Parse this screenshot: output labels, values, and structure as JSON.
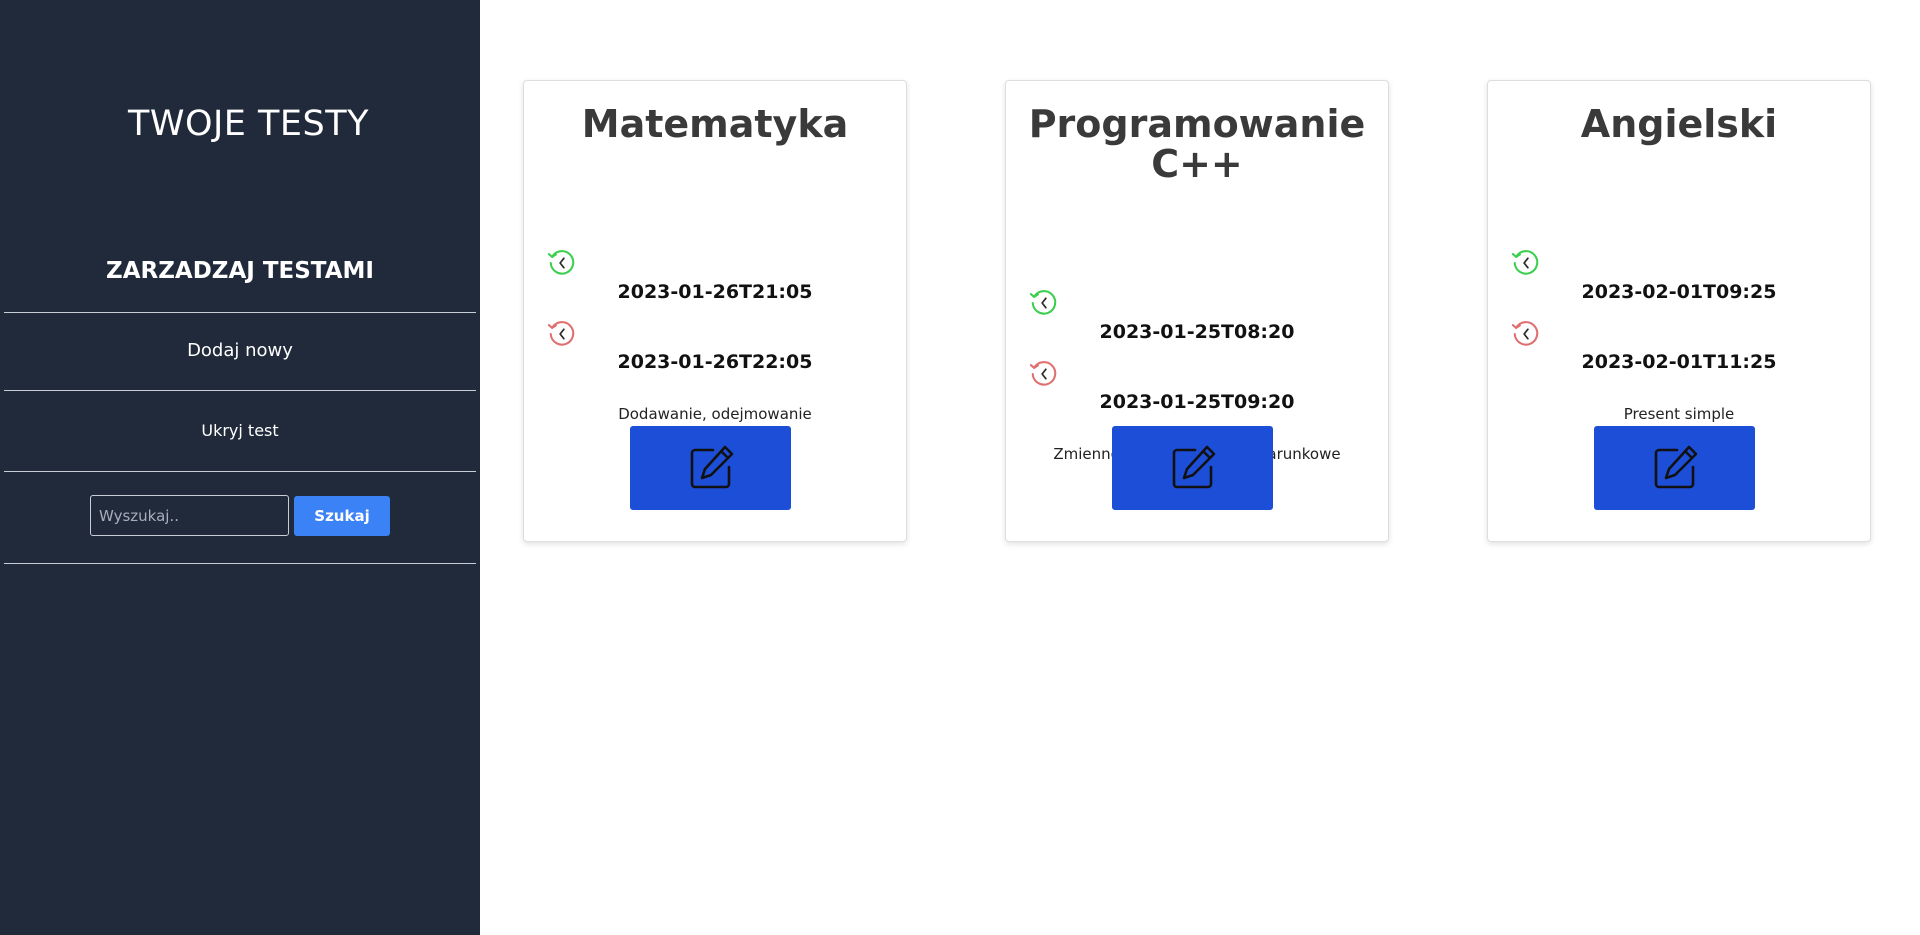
{
  "sidebar": {
    "title": "TWOJE TESTY",
    "manage_heading": "ZARZADZAJ TESTAMI",
    "add_new": "Dodaj nowy",
    "hide_test": "Ukryj test",
    "search_placeholder": "Wyszukaj..",
    "search_button": "Szukaj"
  },
  "colors": {
    "sidebar_bg": "#212a3a",
    "search_button": "#3b82f6",
    "edit_button": "#1d4ed8",
    "start_icon": "#3ccf4e",
    "end_icon": "#e07070"
  },
  "icons": {
    "start": "clock-history-start-icon",
    "end": "clock-history-end-icon",
    "edit": "edit-pencil-square-icon"
  },
  "cards": [
    {
      "title": "Matematyka",
      "start": "2023-01-26T21:05",
      "end": "2023-01-26T22:05",
      "description": "Dodawanie, odejmowanie"
    },
    {
      "title": "Programowanie C++",
      "start": "2023-01-25T08:20",
      "end": "2023-01-25T09:20",
      "description": "Zmienne, pętle, instrukcje warunkowe"
    },
    {
      "title": "Angielski",
      "start": "2023-02-01T09:25",
      "end": "2023-02-01T11:25",
      "description": "Present simple"
    }
  ]
}
